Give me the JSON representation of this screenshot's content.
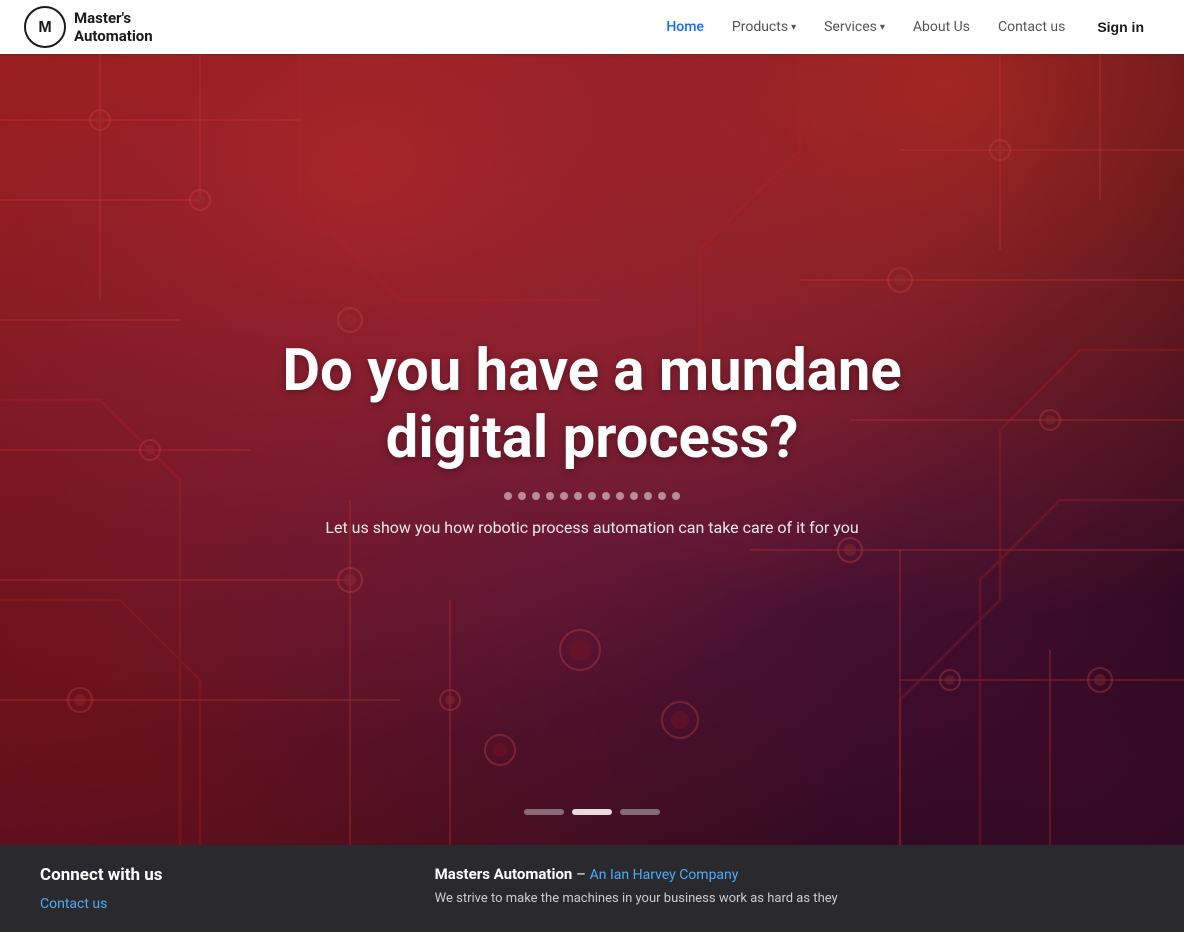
{
  "brand": {
    "name_line1": "Master's",
    "name_line2": "Automation"
  },
  "navbar": {
    "home_label": "Home",
    "products_label": "Products",
    "services_label": "Services",
    "about_label": "About Us",
    "contact_label": "Contact us",
    "signin_label": "Sign in"
  },
  "hero": {
    "title": "Do you have a mundane digital process?",
    "subtitle": "Let us show you how robotic process automation can take care of it for you",
    "dots_count": 13
  },
  "footer": {
    "connect_title": "Connect with us",
    "contact_link": "Contact us",
    "company_name": "Masters Automation",
    "company_sub": "An Ian Harvey Company",
    "company_desc": "We strive to make the machines in your business work as hard as they"
  }
}
